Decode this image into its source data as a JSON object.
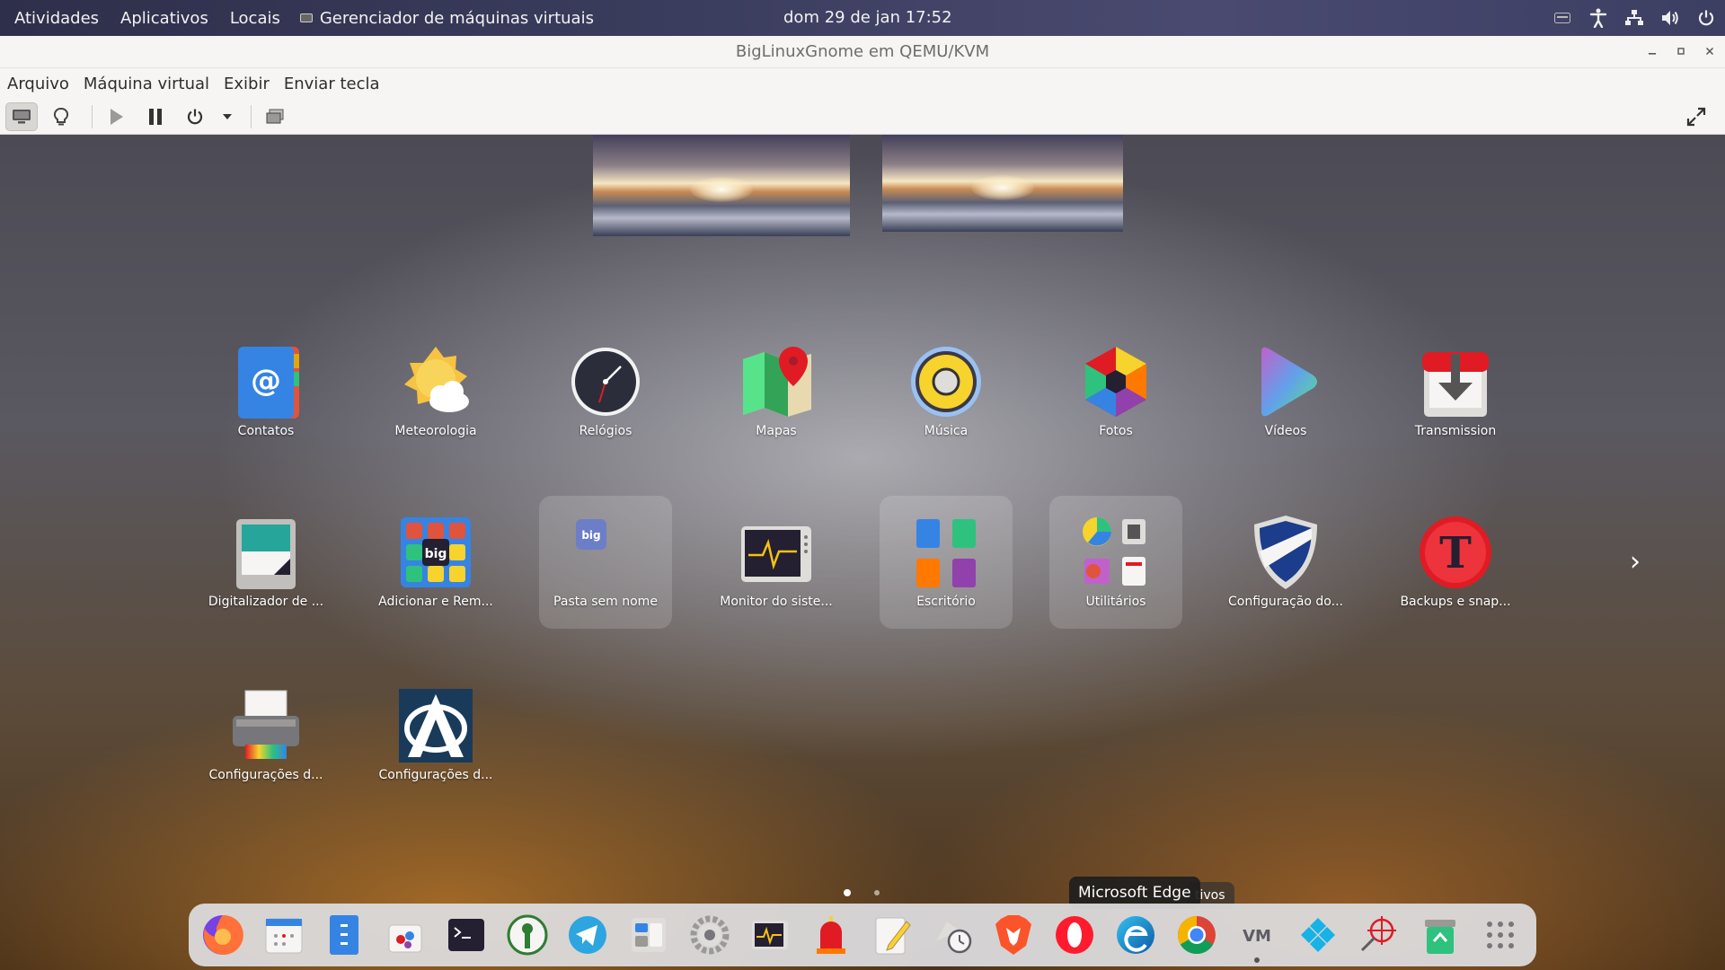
{
  "topbar": {
    "activities": "Atividades",
    "applications": "Aplicativos",
    "places": "Locais",
    "app_menu": "Gerenciador de máquinas virtuais",
    "clock": "dom 29 de jan  17:52",
    "tray_icons": [
      "keyboard-icon",
      "accessibility-icon",
      "network-icon",
      "volume-icon",
      "power-icon"
    ]
  },
  "window": {
    "title": "BigLinuxGnome em QEMU/KVM",
    "menu": [
      "Arquivo",
      "Máquina virtual",
      "Exibir",
      "Enviar tecla"
    ]
  },
  "guest": {
    "apps_row1": [
      "Contatos",
      "Meteorologia",
      "Relógios",
      "Mapas",
      "Música",
      "Fotos",
      "Vídeos",
      "Transmission"
    ],
    "apps_row2": [
      "Digitalizador de ...",
      "Adicionar e Rem...",
      "Pasta sem nome",
      "Monitor do siste...",
      "Escritório",
      "Utilitários",
      "Configuração do...",
      "Backups e snap..."
    ],
    "apps_row3": [
      "Configurações d...",
      "Configurações d..."
    ],
    "tooltip": "Microsoft Edge",
    "tooltip_partial": "tivos",
    "page_count": 2,
    "current_page": 1,
    "colors": {
      "accent": "#3584e4",
      "dash_bg": "#dedee0"
    }
  }
}
